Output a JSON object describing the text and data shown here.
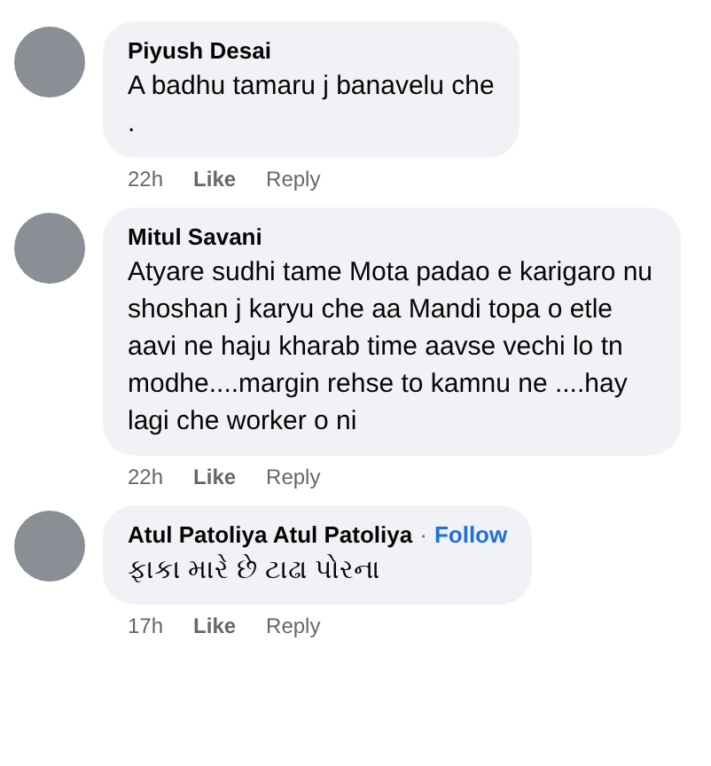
{
  "comments": [
    {
      "author": "Piyush Desai",
      "text": "A badhu tamaru j banavelu che\n.",
      "time": "22h",
      "actions": [
        "Like",
        "Reply"
      ]
    },
    {
      "author": "Mitul Savani",
      "text": "Atyare sudhi tame Mota padao e karigaro nu shoshan j karyu che aa Mandi topa o etle aavi ne haju kharab time aavse vechi lo tn modhe....margin rehse to kamnu ne ....hay lagi che worker o ni",
      "time": "22h",
      "actions": [
        "Like",
        "Reply"
      ]
    },
    {
      "author": "Atul Patoliya Atul Patoliya",
      "separator": "·",
      "follow": "Follow",
      "text": "ફાકા મારે છે ટાઢા પોરના",
      "time": "17h",
      "actions": [
        "Like",
        "Reply"
      ]
    }
  ]
}
